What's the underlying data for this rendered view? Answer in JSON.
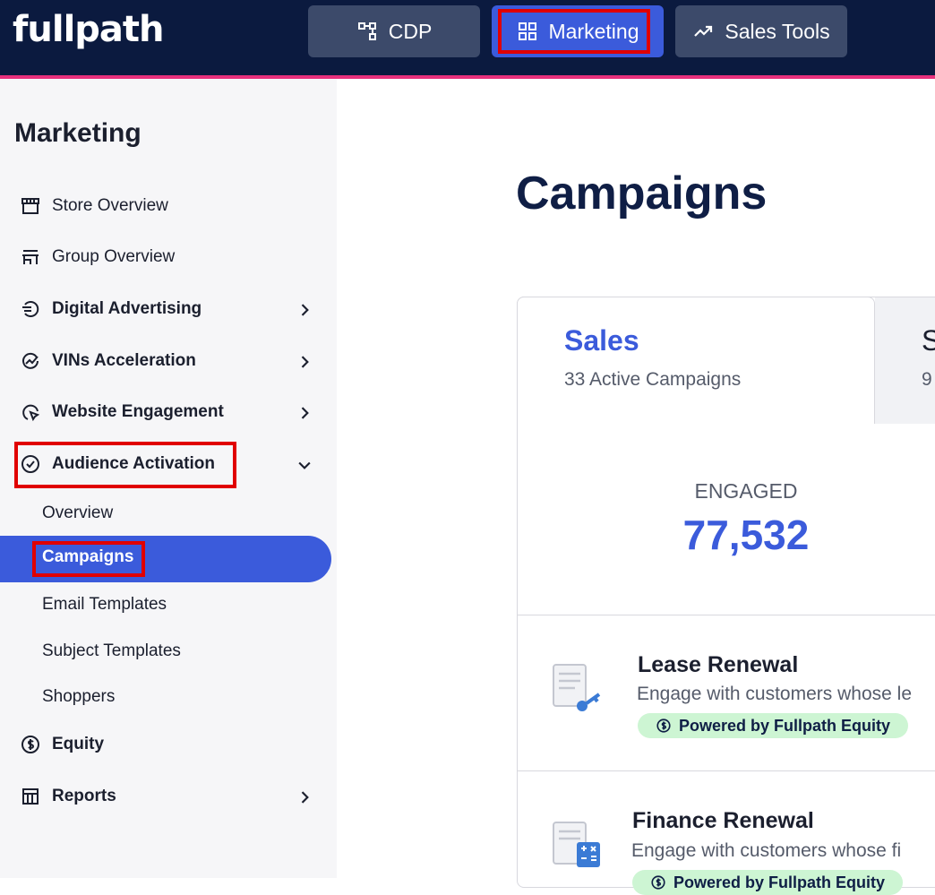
{
  "app": {
    "logo": "fullpath"
  },
  "topnav": {
    "cdp": "CDP",
    "marketing": "Marketing",
    "sales_tools": "Sales Tools"
  },
  "sidebar": {
    "title": "Marketing",
    "items": [
      {
        "label": "Store Overview",
        "icon": "storefront-icon"
      },
      {
        "label": "Group Overview",
        "icon": "store-group-icon"
      },
      {
        "label": "Digital Advertising",
        "icon": "digital-ads-icon"
      },
      {
        "label": "VINs Acceleration",
        "icon": "acceleration-icon"
      },
      {
        "label": "Website Engagement",
        "icon": "cursor-click-icon"
      },
      {
        "label": "Audience Activation",
        "icon": "check-circle-icon"
      },
      {
        "label": "Equity",
        "icon": "dollar-circle-icon"
      },
      {
        "label": "Reports",
        "icon": "reports-icon"
      }
    ],
    "sub_items": [
      "Overview",
      "Campaigns",
      "Email Templates",
      "Subject Templates",
      "Shoppers"
    ]
  },
  "main": {
    "title": "Campaigns",
    "tabs": [
      {
        "title": "Sales",
        "subtitle": "33 Active Campaigns"
      },
      {
        "title": "S",
        "subtitle": "9"
      }
    ],
    "stat": {
      "label": "ENGAGED",
      "value": "77,532"
    },
    "campaigns": [
      {
        "title": "Lease Renewal",
        "desc": "Engage with customers whose le",
        "badge": "Powered by Fullpath Equity"
      },
      {
        "title": "Finance Renewal",
        "desc": "Engage with customers whose fi",
        "badge": "Powered by Fullpath Equity"
      }
    ]
  },
  "colors": {
    "nav_bg": "#0b1a3f",
    "accent": "#3b5bdb",
    "stripe": "#e8307c",
    "badge_bg": "#cdf5d3"
  }
}
